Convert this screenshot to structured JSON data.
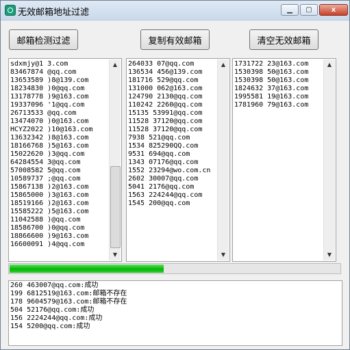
{
  "window": {
    "title": "无效邮箱地址过滤",
    "min_label": "▁",
    "max_label": "▢",
    "close_label": "x"
  },
  "buttons": {
    "detect": "邮箱检测过滤",
    "copy_valid": "复制有效邮箱",
    "clear_invalid": "清空无效邮箱"
  },
  "input_list": [
    "sdxmjy@1 3.com",
    "83467874 @qq.com",
    "13653589 )8@139.com",
    "18234830 )0@qq.com",
    "13178778 )9@163.com",
    "19337096 '1@qq.com",
    "26713533 @qq.com",
    "13474070 )0@163.com",
    "HCYZ2022 )10@163.com",
    "13632342 )8@163.com",
    "18166768 )5@163.com",
    "15022620 )3@qq.com",
    "64284554 3@qq.com",
    "57008582 5@qq.com",
    "10589737 ;@qq.com",
    "15867138 )2@163.com",
    "15865000 )3@163.com",
    "18519166 )2@163.com",
    "15585222 )5@163.com",
    "11042588 )@qq.com",
    "18586700 )0@qq.com",
    "18866600 )9@163.com",
    "16600091 )4@qq.com"
  ],
  "valid_list": [
    "264033 07@qq.com",
    "136534 456@139.com",
    "181716 529@qq.com",
    "131000 062@163.com",
    "124790 2130@qq.com",
    "110242 2260@qq.com",
    "15135 53991@qq.com",
    "11528 37120@qq.com",
    "11528 37120@qq.com",
    "7938 521@qq.com",
    "1534 825290QQ.com",
    "9531 694@qq.com",
    "1343 07176@qq.com",
    "1552 23294@wo.com.cn",
    "2602 30007@qq.com",
    "5041 2176@qq.com",
    "1563 224244@qq.com",
    "1545 200@qq.com"
  ],
  "invalid_list": [
    "1731722 23@163.com",
    "1530398 50@163.com",
    "1530398 50@163.com",
    "1824632 37@163.com",
    "1995581 19@163.com",
    "1781960 79@163.com"
  ],
  "progress": {
    "fraction": 0.47
  },
  "log": [
    "260 463007@qq.com:成功",
    "199 6812519@163.com:邮箱不存在",
    "178 9604579@163.com:邮箱不存在",
    "504 52176@qq.com:成功",
    "156 2224244@qq.com:成功",
    "154 5200@qq.com:成功"
  ]
}
